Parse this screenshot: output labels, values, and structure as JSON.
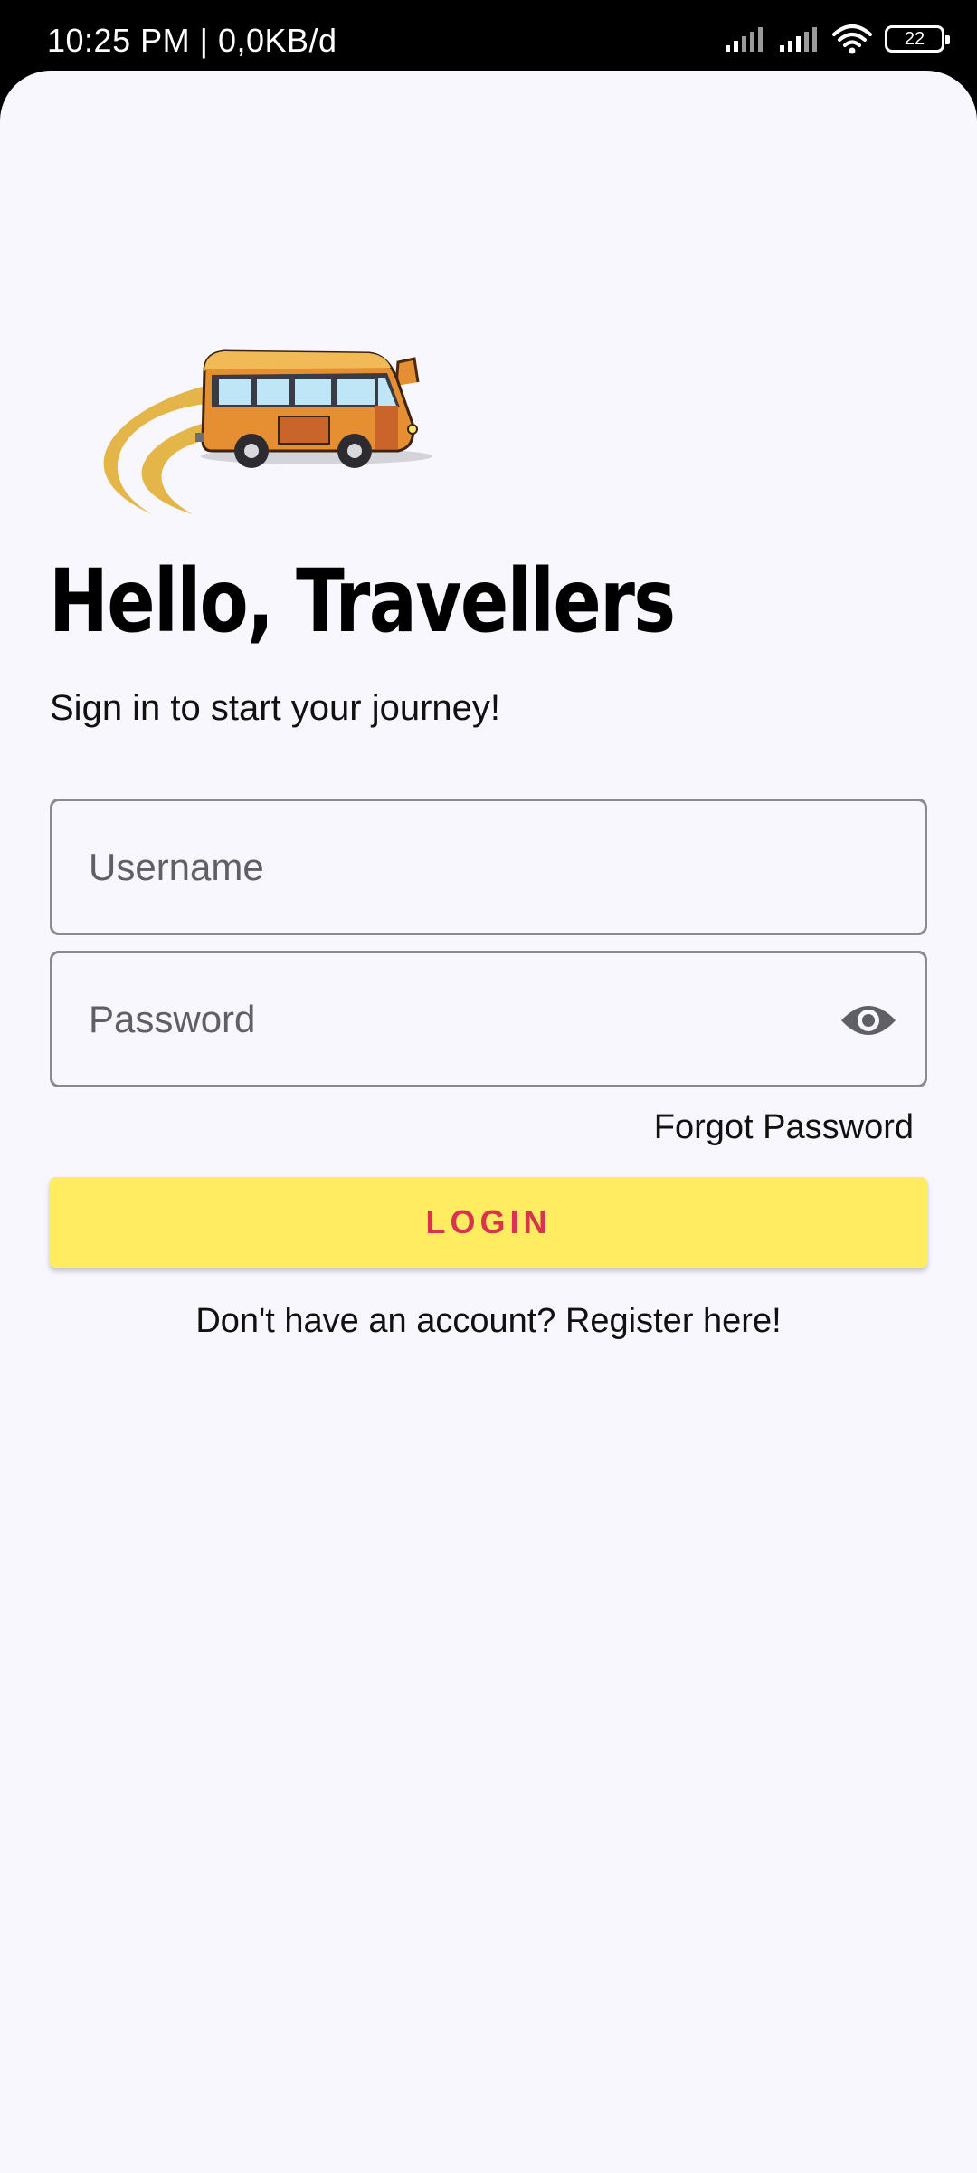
{
  "status_bar": {
    "time": "10:25 PM | 0,0KB/d",
    "battery": "22",
    "icons": [
      "signal-icon",
      "signal-icon",
      "wifi-icon",
      "battery-icon"
    ]
  },
  "header": {
    "logo_icon": "bus-icon",
    "title": "Hello, Travellers",
    "subtitle": "Sign in to start your journey!"
  },
  "form": {
    "username_placeholder": "Username",
    "username_value": "",
    "password_placeholder": "Password",
    "password_value": "",
    "password_toggle_icon": "eye-icon",
    "forgot_label": "Forgot Password",
    "login_label": "LOGIN",
    "register_label": "Don't have an account? Register here!"
  },
  "colors": {
    "background": "#f8f7fd",
    "login_button_bg": "#ffec60",
    "login_button_text": "#d8344f",
    "field_border": "#8a8a8f",
    "bus_body": "#e58e32",
    "bus_roof": "#f2b957",
    "speed_swoosh": "#e4b548"
  }
}
